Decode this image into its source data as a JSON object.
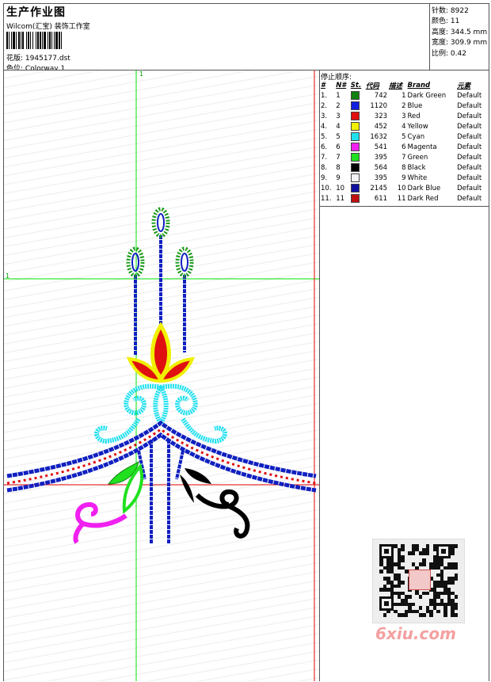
{
  "header": {
    "title": "生产作业图",
    "studio": "Wilcom(汇宝) 装饰工作室",
    "design_label": "花版:",
    "design_value": "1945177.dst",
    "colorway_label": "色位:",
    "colorway_value": "Colorway 1"
  },
  "stats": {
    "stitches_label": "针数:",
    "stitches_value": "8922",
    "colors_label": "颜色:",
    "colors_value": "11",
    "height_label": "高度:",
    "height_value": "344.5 mm",
    "width_label": "宽度:",
    "width_value": "309.9 mm",
    "scale_label": "比例:",
    "scale_value": "0.42"
  },
  "stop_sequence": {
    "title": "停止顺序:",
    "columns": [
      "#",
      "N#",
      "St.",
      "代码",
      "描述",
      "Brand",
      "元素"
    ],
    "rows": [
      {
        "num": "1.",
        "n": "1",
        "color": "#108010",
        "st": "742",
        "code": "1",
        "desc": "Dark Green",
        "brand": "Default"
      },
      {
        "num": "2.",
        "n": "2",
        "color": "#1020e0",
        "st": "1120",
        "code": "2",
        "desc": "Blue",
        "brand": "Default"
      },
      {
        "num": "3.",
        "n": "3",
        "color": "#e01010",
        "st": "323",
        "code": "3",
        "desc": "Red",
        "brand": "Default"
      },
      {
        "num": "4.",
        "n": "4",
        "color": "#f0f000",
        "st": "452",
        "code": "4",
        "desc": "Yellow",
        "brand": "Default"
      },
      {
        "num": "5.",
        "n": "5",
        "color": "#20e0f0",
        "st": "1632",
        "code": "5",
        "desc": "Cyan",
        "brand": "Default"
      },
      {
        "num": "6.",
        "n": "6",
        "color": "#f020f0",
        "st": "541",
        "code": "6",
        "desc": "Magenta",
        "brand": "Default"
      },
      {
        "num": "7.",
        "n": "7",
        "color": "#20e020",
        "st": "395",
        "code": "7",
        "desc": "Green",
        "brand": "Default"
      },
      {
        "num": "8.",
        "n": "8",
        "color": "#000000",
        "st": "564",
        "code": "8",
        "desc": "Black",
        "brand": "Default"
      },
      {
        "num": "9.",
        "n": "9",
        "color": "#f4f4f4",
        "st": "395",
        "code": "9",
        "desc": "White",
        "brand": "Default"
      },
      {
        "num": "10.",
        "n": "10",
        "color": "#1010a0",
        "st": "2145",
        "code": "10",
        "desc": "Dark Blue",
        "brand": "Default"
      },
      {
        "num": "11.",
        "n": "11",
        "color": "#c01010",
        "st": "611",
        "code": "11",
        "desc": "Dark Red",
        "brand": "Default"
      }
    ]
  },
  "canvas": {
    "marker_top": "1",
    "marker_left": "1"
  },
  "watermark": {
    "text": "6xiu.com"
  }
}
